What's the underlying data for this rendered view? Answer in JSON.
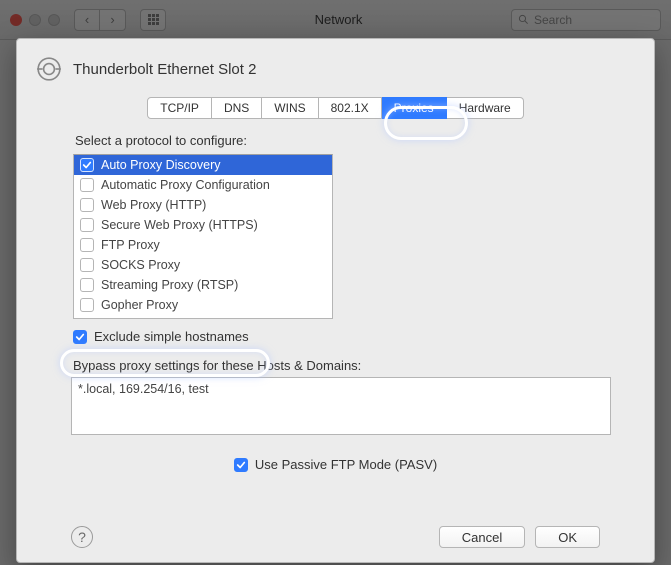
{
  "window": {
    "title": "Network",
    "search_placeholder": "Search"
  },
  "sheet": {
    "title": "Thunderbolt Ethernet Slot 2",
    "tabs": [
      "TCP/IP",
      "DNS",
      "WINS",
      "802.1X",
      "Proxies",
      "Hardware"
    ],
    "active_tab": 4,
    "protocol_label": "Select a protocol to configure:",
    "protocols": [
      {
        "label": "Auto Proxy Discovery",
        "checked": true,
        "selected": true
      },
      {
        "label": "Automatic Proxy Configuration",
        "checked": false,
        "selected": false
      },
      {
        "label": "Web Proxy (HTTP)",
        "checked": false,
        "selected": false
      },
      {
        "label": "Secure Web Proxy (HTTPS)",
        "checked": false,
        "selected": false
      },
      {
        "label": "FTP Proxy",
        "checked": false,
        "selected": false
      },
      {
        "label": "SOCKS Proxy",
        "checked": false,
        "selected": false
      },
      {
        "label": "Streaming Proxy (RTSP)",
        "checked": false,
        "selected": false
      },
      {
        "label": "Gopher Proxy",
        "checked": false,
        "selected": false
      }
    ],
    "exclude_simple": {
      "label": "Exclude simple hostnames",
      "checked": true
    },
    "bypass_label": "Bypass proxy settings for these Hosts & Domains:",
    "bypass_value": "*.local, 169.254/16, test",
    "pasv": {
      "label": "Use Passive FTP Mode (PASV)",
      "checked": true
    },
    "help_glyph": "?",
    "cancel": "Cancel",
    "ok": "OK"
  }
}
